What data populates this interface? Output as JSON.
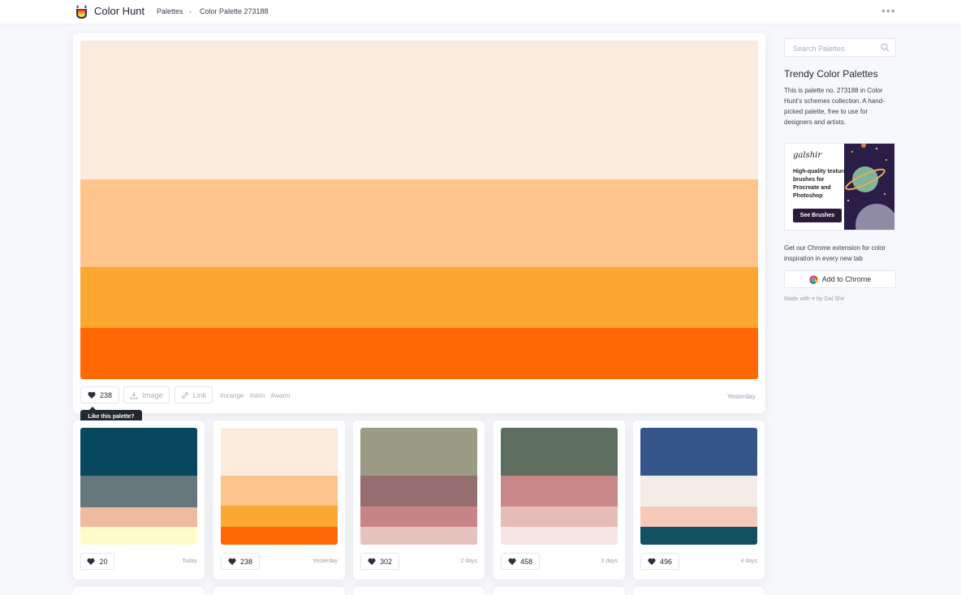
{
  "header": {
    "brand": "Color Hunt",
    "breadcrumb": [
      "Palettes",
      "Color Palette 273188"
    ],
    "breadcrumb_separator": "›",
    "menu_icon": "more-dots-icon"
  },
  "main_palette": {
    "colors": [
      "#fbebdd",
      "#fec48b",
      "#fca730",
      "#ff6803"
    ],
    "likes": "238",
    "image_label": "Image",
    "link_label": "Link",
    "tags": [
      "#orange",
      "#skin",
      "#warm"
    ],
    "date": "Yesterday",
    "tooltip": "Like this palette?"
  },
  "related_palettes": [
    {
      "colors": [
        "#08485e",
        "#66787e",
        "#f0baa0",
        "#fffbcb"
      ],
      "likes": "20",
      "date": "Today"
    },
    {
      "colors": [
        "#fbebdd",
        "#fec48b",
        "#fca730",
        "#ff6803"
      ],
      "likes": "238",
      "date": "Yesterday"
    },
    {
      "colors": [
        "#9b9b86",
        "#956f6f",
        "#c98585",
        "#e6c3bf"
      ],
      "likes": "302",
      "date": "2 days"
    },
    {
      "colors": [
        "#5e6e5e",
        "#c98788",
        "#e6bcb6",
        "#f6e5e4"
      ],
      "likes": "458",
      "date": "3 days"
    },
    {
      "colors": [
        "#34558a",
        "#f2ede8",
        "#f6cabb",
        "#115164"
      ],
      "likes": "496",
      "date": "4 days"
    }
  ],
  "sidebar": {
    "search_placeholder": "Search Palettes",
    "title": "Trendy Color Palettes",
    "description": "This is palette no. 273188 in Color Hunt's schemes collection. A hand-picked palette, free to use for designers and artists.",
    "ad": {
      "signature": "galshir",
      "copy": "High-quality texture brushes for Procreate and Photoshop",
      "button": "See Brushes"
    },
    "extension_text": "Get our Chrome extension for color inspiration in every new tab",
    "chrome_button": "Add to Chrome",
    "made_with_prefix": "Made with",
    "made_with_suffix": "by Gal Shir"
  },
  "colors": {
    "page_bg": "#f7f8fb",
    "tooltip_bg": "#232833",
    "ad_button_bg": "#2c1a3a"
  }
}
